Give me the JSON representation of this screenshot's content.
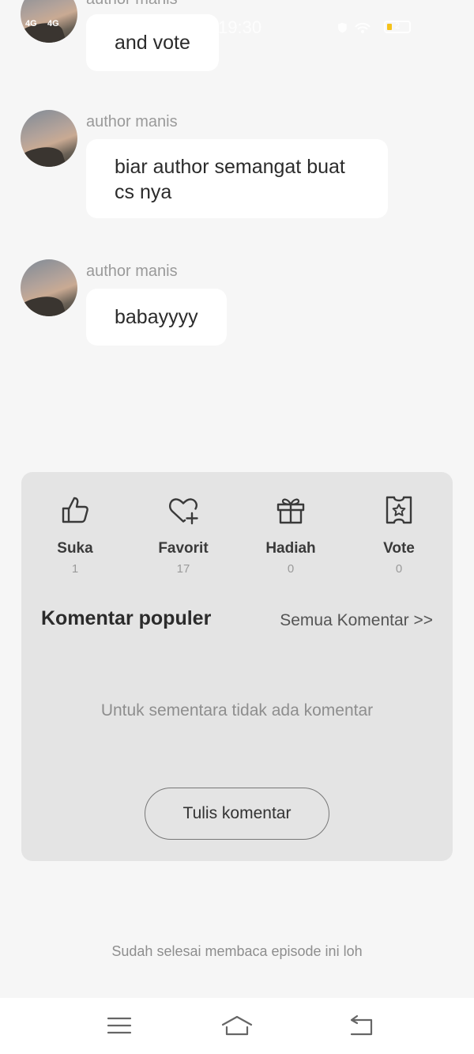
{
  "status_bar": {
    "signal_1": "4G",
    "signal_2": "4G",
    "time": "19:30",
    "battery_level": "2",
    "battery_color": "#f5c21a"
  },
  "comments": [
    {
      "author": "author manis",
      "text": "and vote"
    },
    {
      "author": "author manis",
      "text": "biar author semangat buat cs nya"
    },
    {
      "author": "author manis",
      "text": "babayyyy"
    }
  ],
  "actions": [
    {
      "label": "Suka",
      "count": "1",
      "icon": "thumbs-up-icon"
    },
    {
      "label": "Favorit",
      "count": "17",
      "icon": "heart-plus-icon"
    },
    {
      "label": "Hadiah",
      "count": "0",
      "icon": "gift-icon"
    },
    {
      "label": "Vote",
      "count": "0",
      "icon": "vote-ticket-icon"
    }
  ],
  "popular": {
    "title": "Komentar populer",
    "all_link": "Semua Komentar >>",
    "empty_text": "Untuk sementara tidak ada komentar",
    "write_button": "Tulis komentar"
  },
  "footer_text": "Sudah selesai membaca episode ini loh",
  "nav": {
    "menu_icon": "menu-icon",
    "home_icon": "home-icon",
    "back_icon": "back-icon"
  },
  "colors": {
    "background": "#f6f6f6",
    "panel": "#e4e4e4",
    "bubble": "#ffffff",
    "muted_text": "#9a9a9a"
  }
}
